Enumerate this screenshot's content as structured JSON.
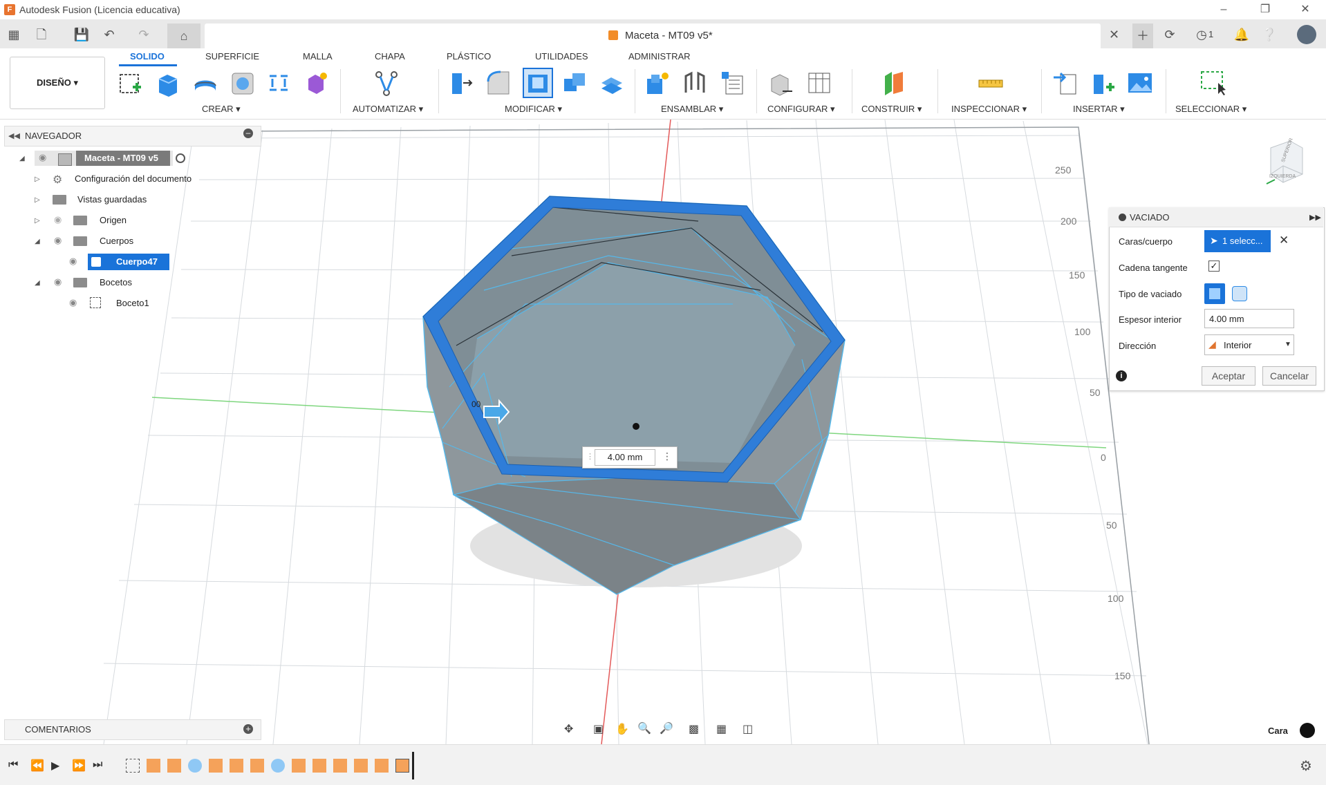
{
  "window": {
    "title": "Autodesk Fusion (Licencia educativa)",
    "logo": "F"
  },
  "document_tab": {
    "title": "Maceta - MT09 v5*"
  },
  "quick_access": {
    "job_count": "1"
  },
  "workspace": {
    "label": "DISEÑO ▾"
  },
  "ribbon": {
    "tabs": [
      "SOLIDO",
      "SUPERFICIE",
      "MALLA",
      "CHAPA",
      "PLÁSTICO",
      "UTILIDADES",
      "ADMINISTRAR"
    ],
    "groups": [
      "CREAR ▾",
      "AUTOMATIZAR ▾",
      "MODIFICAR ▾",
      "ENSAMBLAR ▾",
      "CONFIGURAR ▾",
      "CONSTRUIR ▾",
      "INSPECCIONAR ▾",
      "INSERTAR ▾",
      "SELECCIONAR ▾"
    ]
  },
  "navigator": {
    "title": "NAVEGADOR",
    "root": "Maceta - MT09 v5",
    "items": [
      "Configuración del documento",
      "Vistas guardadas",
      "Origen",
      "Cuerpos",
      "Cuerpo47",
      "Bocetos",
      "Boceto1"
    ]
  },
  "comments": {
    "title": "COMENTARIOS"
  },
  "panel": {
    "title": "VACIADO",
    "faces_label": "Caras/cuerpo",
    "faces_value": "1 selecc...",
    "tangent_label": "Cadena tangente",
    "tangent_checked": true,
    "type_label": "Tipo de vaciado",
    "thickness_label": "Espesor interior",
    "thickness_value": "4.00 mm",
    "direction_label": "Dirección",
    "direction_value": "Interior",
    "ok": "Aceptar",
    "cancel": "Cancelar"
  },
  "viewport": {
    "dimension_value": "4.00 mm",
    "arrow_label": "00",
    "ruler_right": [
      "250",
      "200",
      "150",
      "100",
      "50",
      "0",
      "50",
      "100",
      "150"
    ],
    "viewcube": {
      "top": "SUPERIOR",
      "left": "IZQUIERDA"
    }
  },
  "status": {
    "selection": "Cara"
  },
  "colors": {
    "accent": "#1a73d9",
    "body": "#8a9399",
    "edge": "#4fb3e6",
    "grid": "#d4d8db"
  }
}
